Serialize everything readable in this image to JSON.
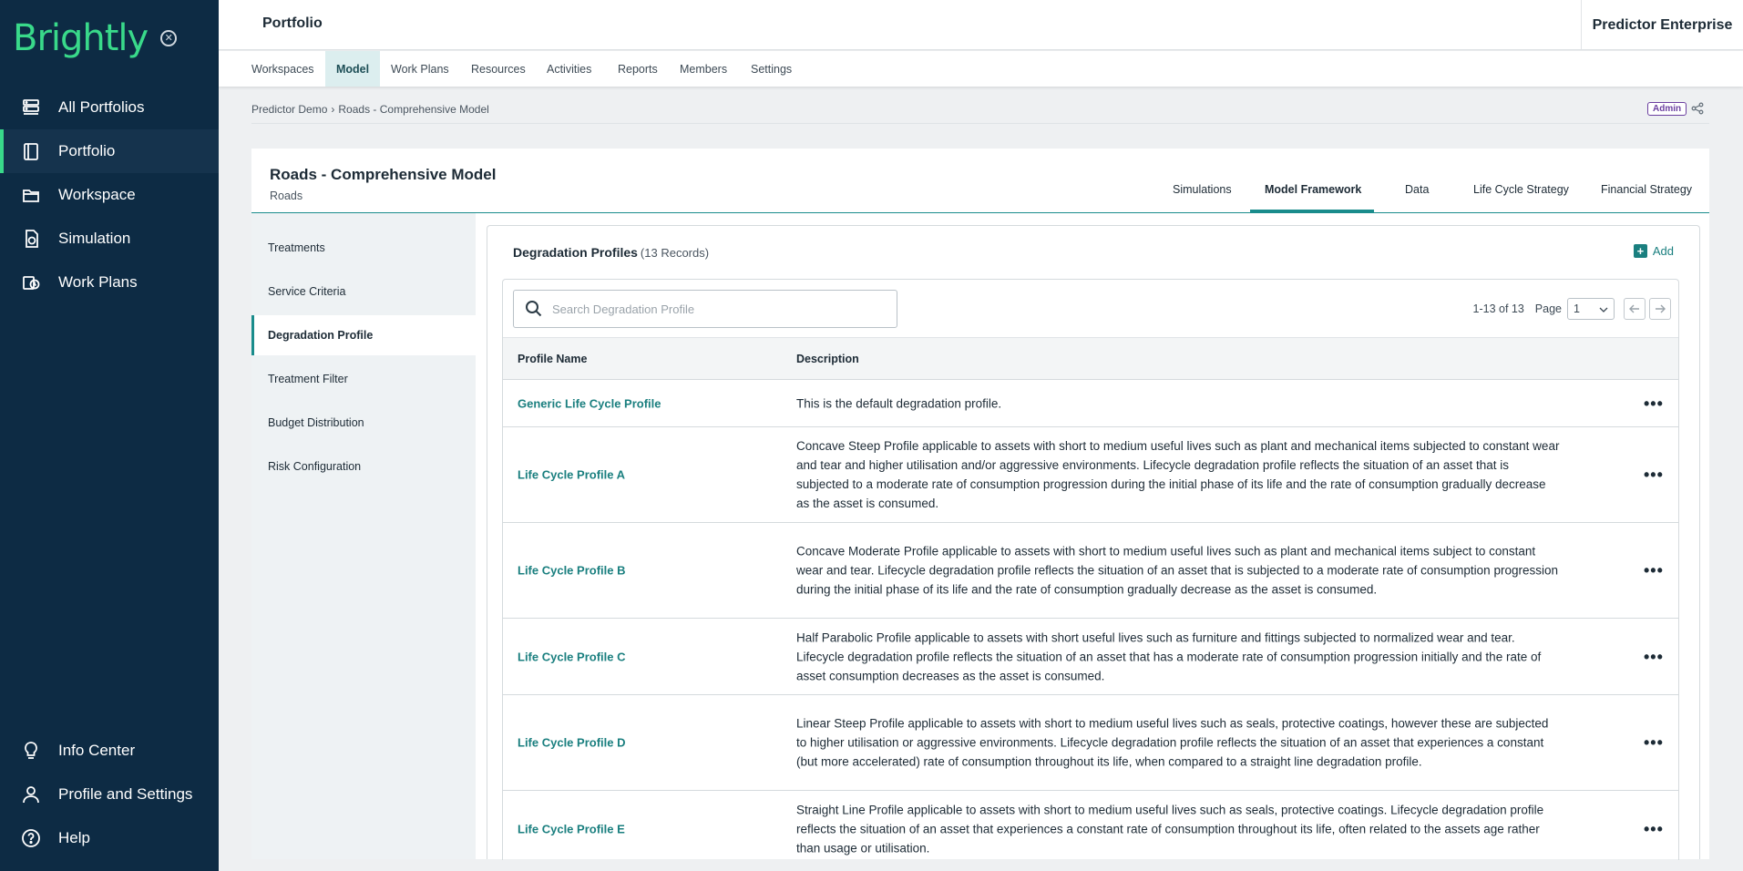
{
  "sidebar": {
    "brand": "Brightly",
    "top_items": [
      {
        "label": "All Portfolios",
        "icon": "portfolios-icon"
      },
      {
        "label": "Portfolio",
        "icon": "book-icon",
        "active": true
      },
      {
        "label": "Workspace",
        "icon": "folder-icon"
      },
      {
        "label": "Simulation",
        "icon": "simulation-icon"
      },
      {
        "label": "Work Plans",
        "icon": "work-plans-icon"
      }
    ],
    "bottom_items": [
      {
        "label": "Info Center",
        "icon": "lightbulb-icon"
      },
      {
        "label": "Profile and Settings",
        "icon": "user-icon"
      },
      {
        "label": "Help",
        "icon": "help-icon"
      }
    ]
  },
  "header": {
    "title": "Portfolio",
    "app_name": "Predictor Enterprise"
  },
  "tabs": [
    {
      "label": "Workspaces"
    },
    {
      "label": "Model",
      "active": true
    },
    {
      "label": "Work Plans"
    },
    {
      "label": "Resources"
    },
    {
      "label": "Activities"
    },
    {
      "label": "Reports"
    },
    {
      "label": "Members"
    },
    {
      "label": "Settings"
    }
  ],
  "breadcrumb": {
    "items": [
      "Predictor Demo",
      "Roads - Comprehensive Model"
    ],
    "separator": "›",
    "badge": "Admin"
  },
  "model": {
    "title": "Roads - Comprehensive Model",
    "subtitle": "Roads",
    "tabs": [
      {
        "label": "Simulations"
      },
      {
        "label": "Model Framework",
        "active": true
      },
      {
        "label": "Data"
      },
      {
        "label": "Life Cycle Strategy"
      },
      {
        "label": "Financial Strategy"
      }
    ]
  },
  "left_nav": [
    {
      "label": "Treatments"
    },
    {
      "label": "Service Criteria"
    },
    {
      "label": "Degradation Profile",
      "active": true
    },
    {
      "label": "Treatment Filter"
    },
    {
      "label": "Budget Distribution"
    },
    {
      "label": "Risk Configuration"
    }
  ],
  "panel": {
    "title": "Degradation Profiles",
    "count": "(13 Records)",
    "add_label": "Add",
    "search_placeholder": "Search Degradation Profile",
    "search_value": "",
    "pager": {
      "range": "1-13 of 13",
      "page_label": "Page",
      "page_value": "1"
    },
    "columns": [
      "Profile Name",
      "Description"
    ],
    "rows": [
      {
        "name": "Generic Life Cycle Profile",
        "description": "This is the default degradation profile."
      },
      {
        "name": "Life Cycle Profile A",
        "description": "Concave Steep Profile applicable to assets with short to medium useful lives such as plant and mechanical items subjected to constant wear and tear and higher utilisation and/or aggressive environments. Lifecycle degradation profile reflects the situation of an asset that is subjected to a moderate rate of consumption progression during the initial phase of its life and the rate of consumption gradually decrease as the asset is consumed."
      },
      {
        "name": "Life Cycle Profile B",
        "description": "Concave Moderate Profile applicable to assets with short to medium useful lives such as plant and mechanical items subject to constant wear and tear. Lifecycle degradation profile reflects the situation of an asset that is subjected to a moderate rate of consumption progression during the initial phase of its life and the rate of consumption gradually decrease as the asset is consumed."
      },
      {
        "name": "Life Cycle Profile C",
        "description": "Half Parabolic Profile applicable to assets with short useful lives such as furniture and fittings subjected to normalized wear and tear. Lifecycle degradation profile reflects the situation of an asset that has a moderate rate of consumption progression initially and the rate of asset consumption decreases as the asset is consumed."
      },
      {
        "name": "Life Cycle Profile D",
        "description": "Linear Steep Profile applicable to assets with short to medium useful lives such as seals, protective coatings, however these are subjected to higher utilisation or aggressive environments. Lifecycle degradation profile reflects the situation of an asset that experiences a constant (but more accelerated) rate of consumption throughout its life, when compared to a straight line degradation profile."
      },
      {
        "name": "Life Cycle Profile E",
        "description": "Straight Line Profile applicable to assets with short to medium useful lives such as seals, protective coatings. Lifecycle degradation profile reflects the situation of an asset that experiences a constant rate of consumption throughout its life, often related to the assets age rather than usage or utilisation."
      }
    ]
  },
  "colors": {
    "sidebar_bg": "#0d2b44",
    "brand_green": "#39d98a",
    "accent_teal": "#1a7f7f",
    "admin_purple": "#6b3fa0"
  }
}
